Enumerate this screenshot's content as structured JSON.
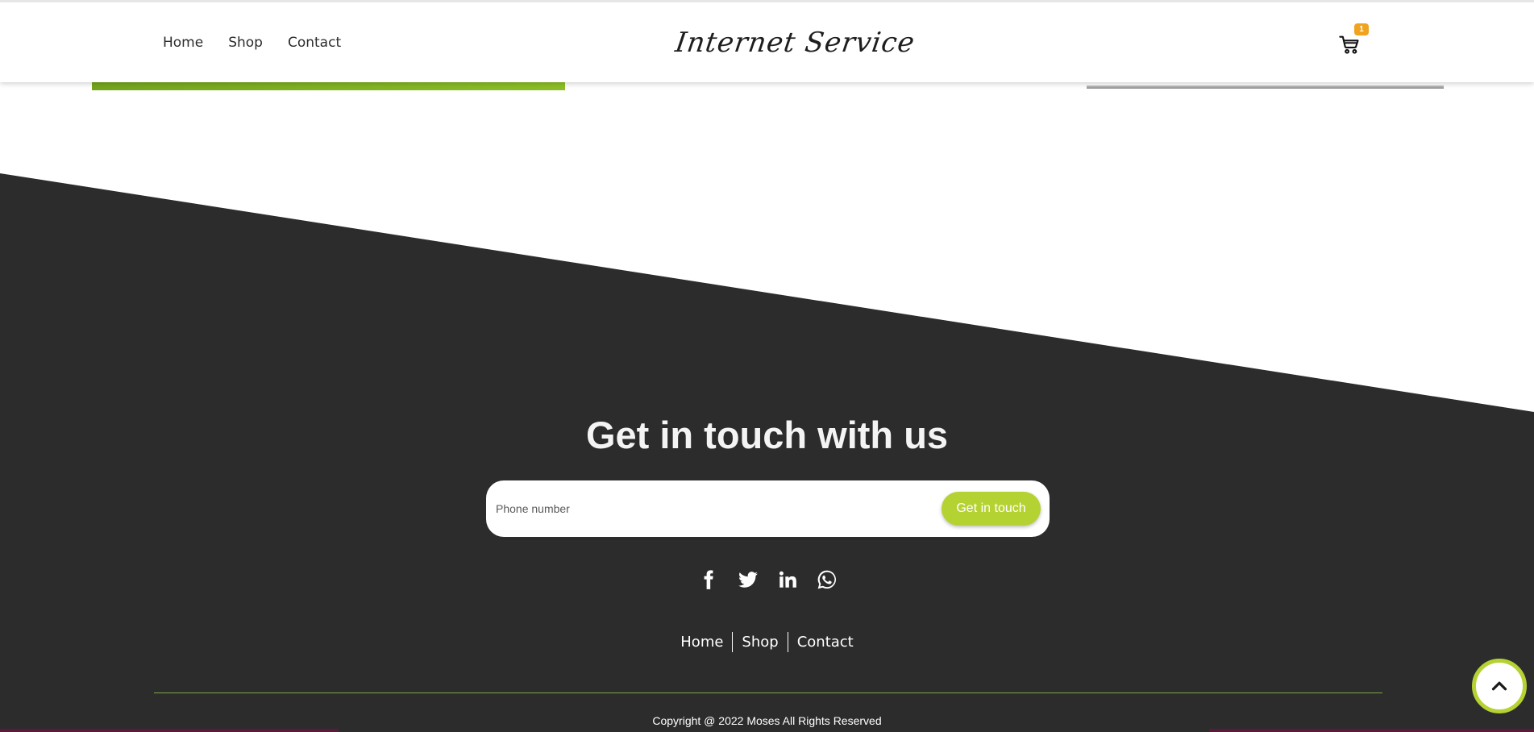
{
  "header": {
    "nav": [
      "Home",
      "Shop",
      "Contact"
    ],
    "logo": "Internet Service",
    "cart_count": "1",
    "cart_icon": "cart-icon"
  },
  "footer": {
    "title": "Get in touch with us",
    "phone_placeholder": "Phone number",
    "submit_label": "Get in touch",
    "social_icons": [
      "facebook-icon",
      "twitter-icon",
      "linkedin-icon",
      "whatsapp-icon"
    ],
    "links": [
      "Home",
      "Shop",
      "Contact"
    ],
    "copyright": "Copyright @ 2022 Moses All Rights Reserved"
  },
  "colors": {
    "accent": "#b5d233",
    "footer_bg": "#2c2c2c",
    "green_strip": "#7aae1f",
    "badge": "#f0a31e"
  }
}
